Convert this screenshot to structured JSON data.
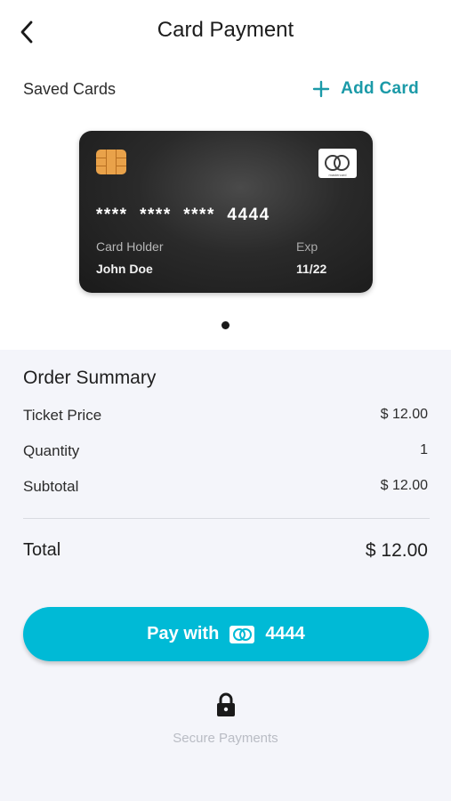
{
  "header": {
    "title": "Card Payment",
    "back_icon": "chevron-left-icon"
  },
  "saved_cards": {
    "label": "Saved Cards",
    "add_label": "Add Card",
    "add_icon": "plus-icon",
    "accent_color": "#1b9aa8"
  },
  "card": {
    "number": "****  ****  ****  4444",
    "holder_label": "Card Holder",
    "holder_name": "John Doe",
    "exp_label": "Exp",
    "exp_value": "11/22",
    "brand_text": "mastercard",
    "chip_icon": "chip-icon",
    "brand_icon": "mastercard-icon"
  },
  "carousel": {
    "current": 1,
    "total": 1
  },
  "summary": {
    "title": "Order Summary",
    "rows": [
      {
        "label": "Ticket Price",
        "value": "$ 12.00"
      },
      {
        "label": "Quantity",
        "value": "1"
      },
      {
        "label": "Subtotal",
        "value": "$ 12.00"
      }
    ],
    "total_label": "Total",
    "total_value": "$ 12.00"
  },
  "pay_button": {
    "label": "Pay with",
    "card_last4": "4444",
    "color": "#00bad6"
  },
  "secure": {
    "text": "Secure Payments",
    "icon": "lock-icon"
  }
}
